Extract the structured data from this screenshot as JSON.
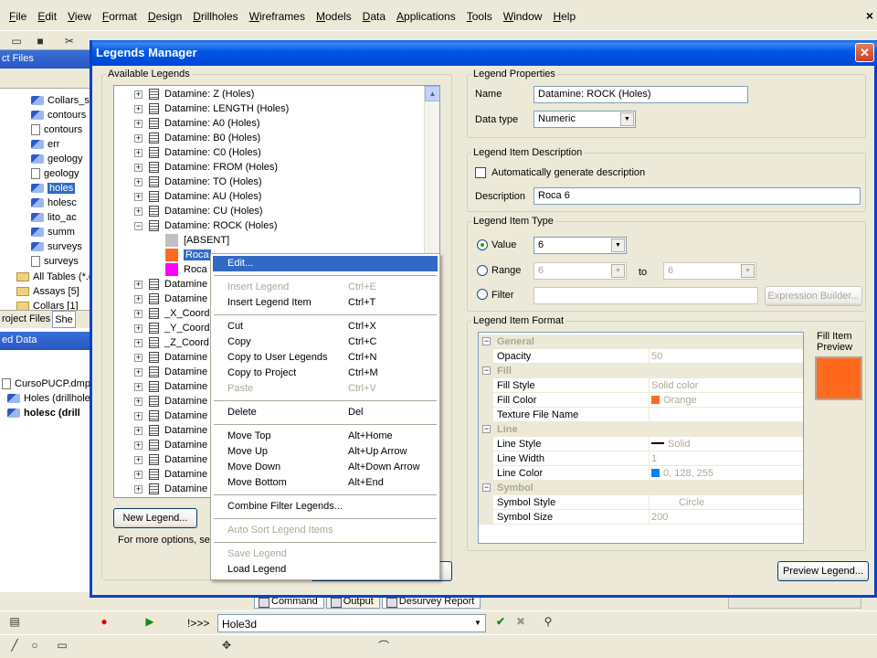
{
  "app": {
    "menu": [
      "File",
      "Edit",
      "View",
      "Format",
      "Design",
      "Drillholes",
      "Wireframes",
      "Models",
      "Data",
      "Applications",
      "Tools",
      "Window",
      "Help"
    ]
  },
  "left_panel": {
    "header1": "ct Files",
    "items": [
      "Collars_s",
      "contours",
      "contours",
      "err",
      "geology",
      "geology",
      "holes",
      "holesc",
      "lito_ac",
      "summ",
      "surveys",
      "surveys",
      "All Tables (*.c",
      "Assays [5]",
      "Collars [1]"
    ],
    "tab1": "roject Files",
    "tab2": "She",
    "header2": "ed Data",
    "data_items": [
      "CursoPUCP.dmpro",
      "Holes (drillhole",
      "holesc (drill"
    ]
  },
  "bottom": {
    "tabs": [
      "Command",
      "Output",
      "Desurvey Report"
    ],
    "cmd_label": "!>>>",
    "cmd_value": "Hole3d"
  },
  "dialog": {
    "title": "Legends Manager",
    "available_legends": {
      "group_label": "Available Legends",
      "rows": [
        "Datamine: Z (Holes)",
        "Datamine: LENGTH (Holes)",
        "Datamine: A0 (Holes)",
        "Datamine: B0 (Holes)",
        "Datamine: C0 (Holes)",
        "Datamine: FROM (Holes)",
        "Datamine: TO (Holes)",
        "Datamine: AU (Holes)",
        "Datamine: CU (Holes)",
        "Datamine: ROCK (Holes)"
      ],
      "children": [
        {
          "label": "[ABSENT]",
          "color": "#C0C0C0"
        },
        {
          "label": "Roca",
          "color": "#FF6A1F"
        },
        {
          "label": "Roca",
          "color": "#FF00FF"
        }
      ],
      "rows_after": [
        "Datamine",
        "Datamine",
        "_X_Coord",
        "_Y_Coord",
        "_Z_Coord",
        "Datamine",
        "Datamine",
        "Datamine",
        "Datamine",
        "Datamine",
        "Datamine",
        "Datamine",
        "Datamine",
        "Datamine",
        "Datamine"
      ],
      "new_button": "New Legend...",
      "footer_text": "For more options, se"
    },
    "legend_properties": {
      "group_label": "Legend Properties",
      "name_label": "Name",
      "name_value": "Datamine: ROCK (Holes)",
      "type_label": "Data type",
      "type_value": "Numeric"
    },
    "item_description": {
      "group_label": "Legend Item Description",
      "auto_label": "Automatically generate description",
      "desc_label": "Description",
      "desc_value": "Roca 6"
    },
    "item_type": {
      "group_label": "Legend Item Type",
      "value_label": "Value",
      "value_value": "6",
      "range_label": "Range",
      "range_from": "6",
      "to_label": "to",
      "range_to": "6",
      "filter_label": "Filter",
      "expr_button": "Expression Builder..."
    },
    "item_format": {
      "group_label": "Legend Item Format",
      "preview_label": "Fill Item Preview",
      "preview_color": "#FF6A1F",
      "general": "General",
      "opacity_label": "Opacity",
      "opacity_value": "50",
      "fill": "Fill",
      "fill_style_label": "Fill Style",
      "fill_style_value": "Solid color",
      "fill_color_label": "Fill Color",
      "fill_color_value": "Orange",
      "texture_label": "Texture File Name",
      "texture_value": "",
      "line": "Line",
      "line_style_label": "Line Style",
      "line_style_value": "Solid",
      "line_width_label": "Line Width",
      "line_width_value": "1",
      "line_color_label": "Line Color",
      "line_color_value": "0, 128, 255",
      "symbol": "Symbol",
      "symbol_style_label": "Symbol Style",
      "symbol_style_value": "Circle",
      "symbol_size_label": "Symbol Size",
      "symbol_size_value": "200"
    },
    "preview_button": "Preview Legend..."
  },
  "context_menu": [
    {
      "label": "Edit...",
      "key": "",
      "state": "highlight"
    },
    {
      "sep": true
    },
    {
      "label": "Insert Legend",
      "key": "Ctrl+E",
      "state": "disabled"
    },
    {
      "label": "Insert Legend Item",
      "key": "Ctrl+T",
      "state": "normal"
    },
    {
      "sep": true
    },
    {
      "label": "Cut",
      "key": "Ctrl+X",
      "state": "normal"
    },
    {
      "label": "Copy",
      "key": "Ctrl+C",
      "state": "normal"
    },
    {
      "label": "Copy to User Legends",
      "key": "Ctrl+N",
      "state": "normal"
    },
    {
      "label": "Copy to Project",
      "key": "Ctrl+M",
      "state": "normal"
    },
    {
      "label": "Paste",
      "key": "Ctrl+V",
      "state": "disabled"
    },
    {
      "sep": true
    },
    {
      "label": "Delete",
      "key": "Del",
      "state": "normal"
    },
    {
      "sep": true
    },
    {
      "label": "Move Top",
      "key": "Alt+Home",
      "state": "normal"
    },
    {
      "label": "Move Up",
      "key": "Alt+Up Arrow",
      "state": "normal"
    },
    {
      "label": "Move Down",
      "key": "Alt+Down Arrow",
      "state": "normal"
    },
    {
      "label": "Move Bottom",
      "key": "Alt+End",
      "state": "normal"
    },
    {
      "sep": true
    },
    {
      "label": "Combine Filter Legends...",
      "key": "",
      "state": "normal"
    },
    {
      "sep": true
    },
    {
      "label": "Auto Sort Legend Items",
      "key": "",
      "state": "disabled"
    },
    {
      "sep": true
    },
    {
      "label": "Save Legend",
      "key": "",
      "state": "disabled"
    },
    {
      "label": "Load Legend",
      "key": "",
      "state": "normal"
    }
  ]
}
